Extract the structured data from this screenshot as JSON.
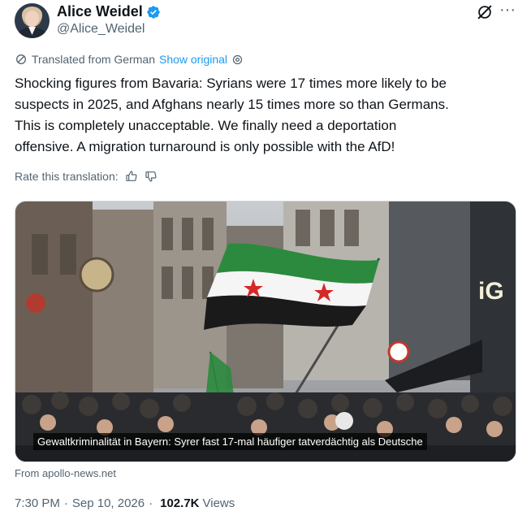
{
  "author": {
    "display_name": "Alice Weidel",
    "handle": "@Alice_Weidel",
    "verified_color": "#1d9bf0"
  },
  "translation": {
    "label": "Translated from German",
    "show_original": "Show original"
  },
  "tweet": {
    "line1": "Shocking figures from Bavaria: Syrians were 17 times more likely to be",
    "line2": "suspects in 2025, and Afghans nearly 15 times more so than Germans.",
    "line3": "This is completely unacceptable. We finally need a deportation",
    "line4": "offensive. A migration turnaround is only possible with the AfD!"
  },
  "rate": {
    "label": "Rate this translation:"
  },
  "media": {
    "caption": "Gewaltkriminalität in Bayern: Syrer fast 17-mal häufiger tatverdächtig als Deutsche",
    "source": "From apollo-news.net"
  },
  "meta": {
    "time": "7:30 PM",
    "date": "Sep 10, 2026",
    "views_count": "102.7K",
    "views_label": "Views"
  },
  "icons": {
    "verified": "verified-badge-icon",
    "grok": "grok-icon",
    "more": "more-dots-icon",
    "globe": "translate-globe-icon",
    "gear": "settings-gear-icon",
    "thumbs_up": "thumbs-up-icon",
    "thumbs_down": "thumbs-down-icon"
  }
}
